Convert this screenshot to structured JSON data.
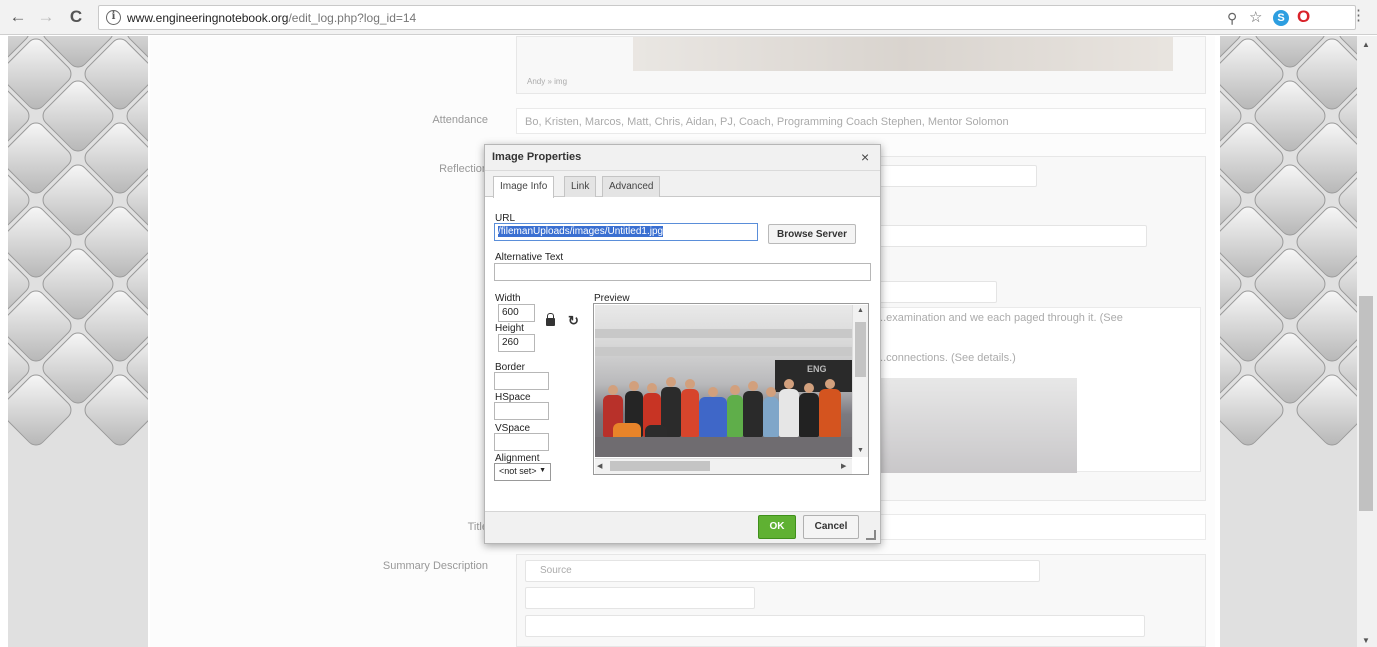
{
  "browser": {
    "url_domain": "www.engineeringnotebook.org",
    "url_path": "/edit_log.php?log_id=14"
  },
  "page": {
    "image_caption": "Andy  »  img",
    "attendance": {
      "label": "Attendance",
      "value": "Bo, Kristen, Marcos, Matt, Chris, Aidan, PJ, Coach, Programming Coach Stephen, Mentor Solomon"
    },
    "reflection": {
      "label": "Reflection",
      "text_line1": "...examination and we each paged through it. (See",
      "text_line2": "...connections. (See details.)"
    },
    "title": {
      "label": "Title"
    },
    "summary": {
      "label": "Summary Description",
      "source_label": "Source"
    }
  },
  "dialog": {
    "title": "Image Properties",
    "close_label": "×",
    "tabs": [
      {
        "label": "Image Info"
      },
      {
        "label": "Link"
      },
      {
        "label": "Advanced"
      }
    ],
    "url": {
      "label": "URL",
      "value": "/filemanUploads/images/Untitled1.jpg"
    },
    "browse_label": "Browse Server",
    "alt": {
      "label": "Alternative Text",
      "value": ""
    },
    "width": {
      "label": "Width",
      "value": "600"
    },
    "height": {
      "label": "Height",
      "value": "260"
    },
    "border": {
      "label": "Border",
      "value": ""
    },
    "hspace": {
      "label": "HSpace",
      "value": ""
    },
    "vspace": {
      "label": "VSpace",
      "value": ""
    },
    "alignment": {
      "label": "Alignment",
      "value": "<not set>"
    },
    "preview_label": "Preview",
    "preview_banner": "ENG",
    "ok_label": "OK",
    "cancel_label": "Cancel"
  },
  "colors": {
    "ok_green": "#5fb132",
    "selection_blue": "#3a6fd1",
    "opera_red": "#d9222a",
    "skype_blue": "#2d9ee0"
  }
}
